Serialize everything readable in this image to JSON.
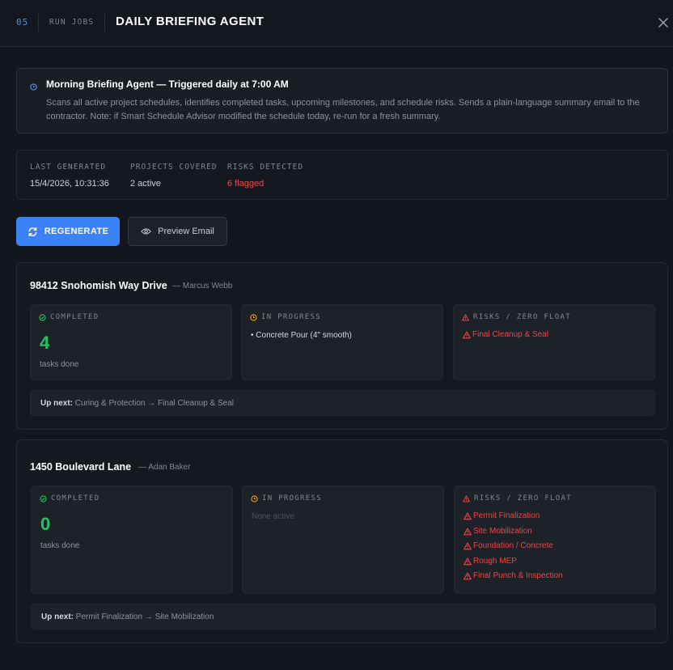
{
  "header": {
    "step": "05",
    "crumb": "RUN JOBS",
    "title": "DAILY BRIEFING AGENT",
    "close_icon": "close-icon"
  },
  "info": {
    "title": "Morning Briefing Agent — Triggered daily at 7:00 AM",
    "description": "Scans all active project schedules, identifies completed tasks, upcoming milestones, and schedule risks. Sends a plain-language summary email to the contractor. Note: if Smart Schedule Advisor modified the schedule today, re-run for a fresh summary.",
    "icon": "clock-icon"
  },
  "stats": [
    {
      "label": "LAST GENERATED",
      "value": "15/4/2026, 10:31:36"
    },
    {
      "label": "PROJECTS COVERED",
      "value": "2 active"
    },
    {
      "label": "RISKS DETECTED",
      "value": "6 flagged"
    }
  ],
  "actions": {
    "regenerate": "REGENERATE",
    "preview": "Preview Email"
  },
  "labels": {
    "completed": "COMPLETED",
    "in_progress": "IN PROGRESS",
    "risks": "RISKS / ZERO FLOAT",
    "tasks_done": "tasks done",
    "up_next": "Up next:"
  },
  "projects": [
    {
      "name": "98412 Snohomish Way Drive",
      "owner": "— Marcus Webb",
      "completed": "4",
      "in_progress": [
        "• Concrete Pour (4\" smooth)"
      ],
      "in_progress_empty": "",
      "risks": [
        "Final Cleanup & Seal"
      ],
      "up_next": "Curing & Protection → Final Cleanup & Seal"
    },
    {
      "name": "1450 Boulevard Lane",
      "owner": "— Adan Baker",
      "completed": "0",
      "in_progress": [],
      "in_progress_empty": "None active",
      "risks": [
        "Permit Finalization",
        "Site Mobilization",
        "Foundation / Concrete",
        "Rough MEP",
        "Final Punch & Inspection"
      ],
      "up_next": "Permit Finalization → Site Mobilization"
    }
  ],
  "colors": {
    "accent": "#3b82f6",
    "success": "#22c55e",
    "warning": "#f59e0b",
    "danger": "#ef4444",
    "background": "#13171d"
  }
}
